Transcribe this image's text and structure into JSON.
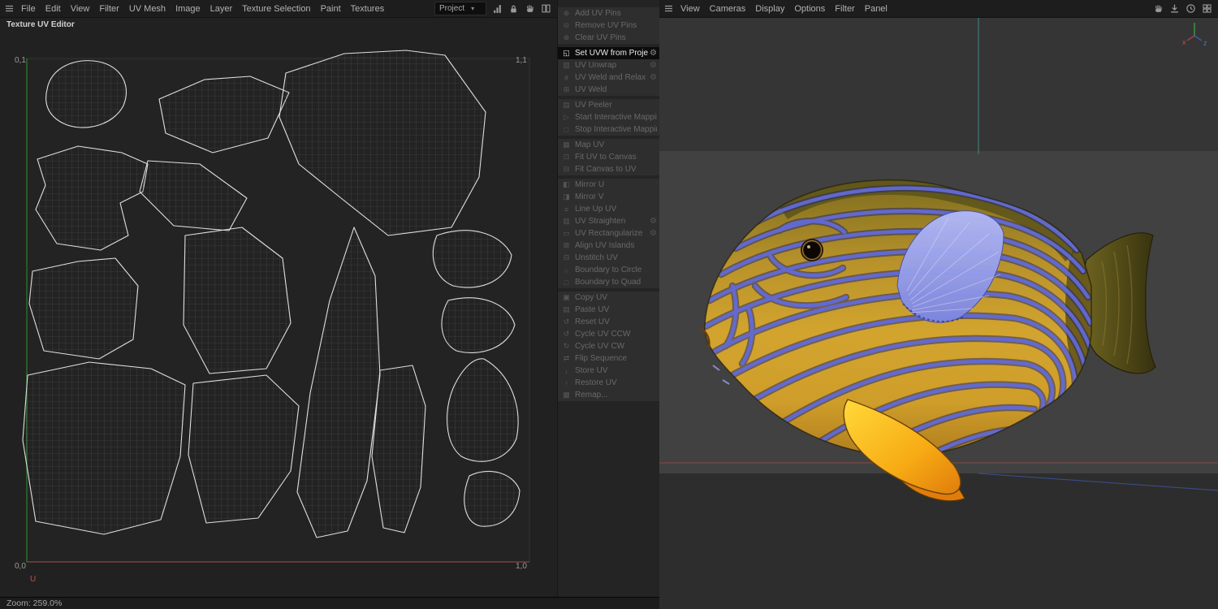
{
  "left_menubar": {
    "items": [
      "File",
      "Edit",
      "View",
      "Filter",
      "UV Mesh",
      "Image",
      "Layer",
      "Texture Selection",
      "Paint",
      "Textures"
    ],
    "project_dropdown": "Project"
  },
  "uv_editor": {
    "title": "Texture UV Editor",
    "corners": {
      "tl": "0,1",
      "tr": "1,1",
      "bl": "0,0",
      "br": "1,0"
    },
    "u_axis_label": "U",
    "zoom_status": "Zoom: 259.0%"
  },
  "tool_menu": {
    "items": [
      {
        "label": "Add UV Pins",
        "icon": "pin-add-icon",
        "enabled": false,
        "gear": false,
        "group_start": false
      },
      {
        "label": "Remove UV Pins",
        "icon": "pin-remove-icon",
        "enabled": false,
        "gear": false,
        "group_start": false
      },
      {
        "label": "Clear UV Pins",
        "icon": "pin-clear-icon",
        "enabled": false,
        "gear": false,
        "group_start": false
      },
      {
        "label": "Set UVW from Projection",
        "icon": "projection-icon",
        "enabled": true,
        "selected": true,
        "gear": true,
        "group_start": true
      },
      {
        "label": "UV Unwrap",
        "icon": "unwrap-icon",
        "enabled": false,
        "gear": true,
        "group_start": false
      },
      {
        "label": "UV Weld and Relax",
        "icon": "weld-relax-icon",
        "enabled": false,
        "gear": true,
        "group_start": false
      },
      {
        "label": "UV Weld",
        "icon": "weld-icon",
        "enabled": false,
        "gear": false,
        "group_start": false
      },
      {
        "label": "UV Peeler",
        "icon": "peeler-icon",
        "enabled": false,
        "gear": false,
        "group_start": true
      },
      {
        "label": "Start Interactive Mapping",
        "icon": "play-icon",
        "enabled": false,
        "gear": false,
        "group_start": false
      },
      {
        "label": "Stop Interactive Mapping",
        "icon": "stop-icon",
        "enabled": false,
        "gear": false,
        "group_start": false
      },
      {
        "label": "Map UV",
        "icon": "map-icon",
        "enabled": false,
        "gear": false,
        "group_start": true
      },
      {
        "label": "Fit UV to Canvas",
        "icon": "fit-uv-icon",
        "enabled": false,
        "gear": false,
        "group_start": false
      },
      {
        "label": "Fit Canvas to UV",
        "icon": "fit-canvas-icon",
        "enabled": false,
        "gear": false,
        "group_start": false
      },
      {
        "label": "Mirror U",
        "icon": "mirror-u-icon",
        "enabled": false,
        "gear": false,
        "group_start": true
      },
      {
        "label": "Mirror V",
        "icon": "mirror-v-icon",
        "enabled": false,
        "gear": false,
        "group_start": false
      },
      {
        "label": "Line Up UV",
        "icon": "lineup-icon",
        "enabled": false,
        "gear": false,
        "group_start": false
      },
      {
        "label": "UV Straighten",
        "icon": "straighten-icon",
        "enabled": false,
        "gear": true,
        "group_start": false
      },
      {
        "label": "UV Rectangularize",
        "icon": "rectangularize-icon",
        "enabled": false,
        "gear": true,
        "group_start": false
      },
      {
        "label": "Align UV Islands",
        "icon": "align-icon",
        "enabled": false,
        "gear": false,
        "group_start": false
      },
      {
        "label": "Unstitch UV",
        "icon": "unstitch-icon",
        "enabled": false,
        "gear": false,
        "group_start": false
      },
      {
        "label": "Boundary to Circle",
        "icon": "circle-icon",
        "enabled": false,
        "gear": false,
        "group_start": false
      },
      {
        "label": "Boundary to Quad",
        "icon": "quad-icon",
        "enabled": false,
        "gear": false,
        "group_start": false
      },
      {
        "label": "Copy UV",
        "icon": "copy-icon",
        "enabled": false,
        "gear": false,
        "group_start": true
      },
      {
        "label": "Paste UV",
        "icon": "paste-icon",
        "enabled": false,
        "gear": false,
        "group_start": false
      },
      {
        "label": "Reset UV",
        "icon": "reset-icon",
        "enabled": false,
        "gear": false,
        "group_start": false
      },
      {
        "label": "Cycle UV CCW",
        "icon": "ccw-icon",
        "enabled": false,
        "gear": false,
        "group_start": false
      },
      {
        "label": "Cycle UV CW",
        "icon": "cw-icon",
        "enabled": false,
        "gear": false,
        "group_start": false
      },
      {
        "label": "Flip Sequence",
        "icon": "flip-icon",
        "enabled": false,
        "gear": false,
        "group_start": false
      },
      {
        "label": "Store UV",
        "icon": "store-icon",
        "enabled": false,
        "gear": false,
        "group_start": false
      },
      {
        "label": "Restore UV",
        "icon": "restore-icon",
        "enabled": false,
        "gear": false,
        "group_start": false
      },
      {
        "label": "Remap...",
        "icon": "remap-icon",
        "enabled": false,
        "gear": false,
        "group_start": false
      }
    ]
  },
  "viewport": {
    "menubar_items": [
      "View",
      "Cameras",
      "Display",
      "Options",
      "Filter",
      "Panel"
    ],
    "gizmo": {
      "x": "x",
      "z": "z"
    }
  },
  "colors": {
    "selected_row_bg": "#0c0c0c",
    "disabled_text": "#696969",
    "panel_bg": "#242424",
    "canvas_bg": "#212121",
    "viewport_bg": "#414141",
    "stripe_blue": "#636bd6",
    "body_yellow": "#d2a42e",
    "pectoral_fin_blue": "#99a2ef",
    "pelvic_fin_orange": "#f2a012",
    "axis_red": "#9a4a46",
    "axis_green": "#2f7d33",
    "axis_teal": "#3e8a80"
  }
}
